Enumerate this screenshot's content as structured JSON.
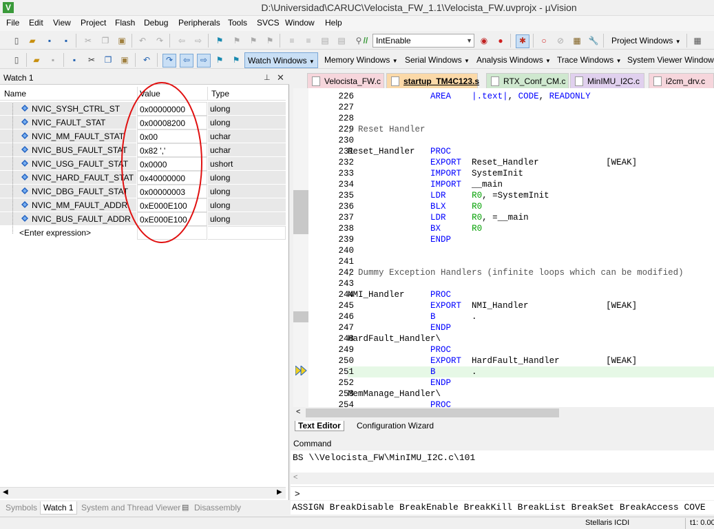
{
  "window": {
    "title": "D:\\Universidad\\CARUC\\Velocista_FW_1.1\\Velocista_FW.uvprojx - µVision"
  },
  "menu": [
    "File",
    "Edit",
    "View",
    "Project",
    "Flash",
    "Debug",
    "Peripherals",
    "Tools",
    "SVCS",
    "Window",
    "Help"
  ],
  "toolbar1": {
    "combo_value": "IntEnable",
    "project_windows": "Project Windows"
  },
  "toolbar2": {
    "watch_windows": "Watch Windows",
    "memory_windows": "Memory Windows",
    "serial_windows": "Serial Windows",
    "analysis_windows": "Analysis Windows",
    "trace_windows": "Trace Windows",
    "system_viewer_windows": "System Viewer Windows"
  },
  "watch": {
    "title": "Watch 1",
    "columns": {
      "name": "Name",
      "value": "Value",
      "type": "Type"
    },
    "rows": [
      {
        "name": "NVIC_SYSH_CTRL_ST",
        "value": "0x00000000",
        "type": "ulong"
      },
      {
        "name": "NVIC_FAULT_STAT",
        "value": "0x00008200",
        "type": "ulong"
      },
      {
        "name": "NVIC_MM_FAULT_STAT",
        "value": "0x00",
        "type": "uchar"
      },
      {
        "name": "NVIC_BUS_FAULT_STAT",
        "value": "0x82 ','",
        "type": "uchar"
      },
      {
        "name": "NVIC_USG_FAULT_STAT",
        "value": "0x0000",
        "type": "ushort"
      },
      {
        "name": "NVIC_HARD_FAULT_STAT",
        "value": "0x40000000",
        "type": "ulong"
      },
      {
        "name": "NVIC_DBG_FAULT_STAT",
        "value": "0x00000003",
        "type": "ulong"
      },
      {
        "name": "NVIC_MM_FAULT_ADDR",
        "value": "0xE000E100",
        "type": "ulong"
      },
      {
        "name": "NVIC_BUS_FAULT_ADDR",
        "value": "0xE000E100",
        "type": "ulong"
      }
    ],
    "enter_expression": "<Enter expression>",
    "highlight_color": "#e01010"
  },
  "left_tabs": [
    "Symbols",
    "Watch 1",
    "System and Thread Viewer",
    "Disassembly"
  ],
  "editor_tabs": [
    {
      "label": "Velocista_FW.c",
      "color": "#f6d6dc"
    },
    {
      "label": "startup_TM4C123.s",
      "color": "#fbd9a8",
      "active": true
    },
    {
      "label": "RTX_Conf_CM.c",
      "color": "#cfe8cf"
    },
    {
      "label": "MinIMU_I2C.c",
      "color": "#e0d0ee"
    },
    {
      "label": "i2cm_drv.c",
      "color": "#f6d6dc"
    }
  ],
  "code": [
    {
      "n": "226",
      "t": "                AREA    |.text|, CODE, READONLY"
    },
    {
      "n": "227",
      "t": ""
    },
    {
      "n": "228",
      "t": ""
    },
    {
      "n": "229",
      "t": "; Reset Handler"
    },
    {
      "n": "230",
      "t": ""
    },
    {
      "n": "231",
      "t": "Reset_Handler   PROC"
    },
    {
      "n": "232",
      "t": "                EXPORT  Reset_Handler             [WEAK]"
    },
    {
      "n": "233",
      "t": "                IMPORT  SystemInit"
    },
    {
      "n": "234",
      "t": "                IMPORT  __main"
    },
    {
      "n": "235",
      "t": "                LDR     R0, =SystemInit"
    },
    {
      "n": "236",
      "t": "                BLX     R0"
    },
    {
      "n": "237",
      "t": "                LDR     R0, =__main"
    },
    {
      "n": "238",
      "t": "                BX      R0"
    },
    {
      "n": "239",
      "t": "                ENDP"
    },
    {
      "n": "240",
      "t": ""
    },
    {
      "n": "241",
      "t": ""
    },
    {
      "n": "242",
      "t": "; Dummy Exception Handlers (infinite loops which can be modified)"
    },
    {
      "n": "243",
      "t": ""
    },
    {
      "n": "244",
      "t": "NMI_Handler     PROC"
    },
    {
      "n": "245",
      "t": "                EXPORT  NMI_Handler               [WEAK]"
    },
    {
      "n": "246",
      "t": "                B       ."
    },
    {
      "n": "247",
      "t": "                ENDP"
    },
    {
      "n": "248",
      "t": "HardFault_Handler\\"
    },
    {
      "n": "249",
      "t": "                PROC"
    },
    {
      "n": "250",
      "t": "                EXPORT  HardFault_Handler         [WEAK]"
    },
    {
      "n": "251",
      "t": "                B       ."
    },
    {
      "n": "252",
      "t": "                ENDP"
    },
    {
      "n": "253",
      "t": "MemManage_Handler\\"
    },
    {
      "n": "254",
      "t": "                PROC"
    }
  ],
  "editor_bottom_tabs": [
    "Text Editor",
    "Configuration Wizard"
  ],
  "command": {
    "title": "Command",
    "output": "BS \\\\Velocista_FW\\MinIMU_I2C.c\\101",
    "prompt": ">",
    "hints": "ASSIGN BreakDisable BreakEnable BreakKill BreakList BreakSet BreakAccess COVE"
  },
  "status": {
    "debugger": "Stellaris ICDI",
    "time": "t1: 0.00"
  }
}
